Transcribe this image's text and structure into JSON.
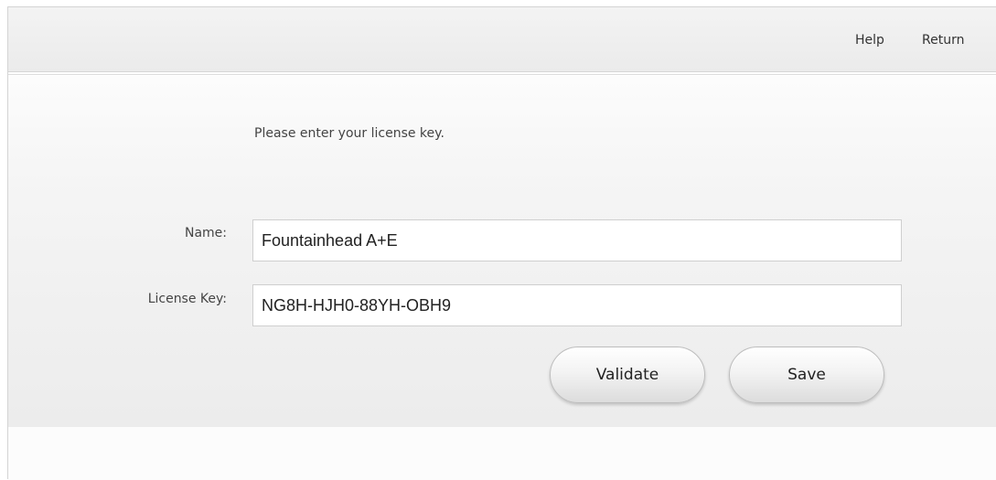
{
  "header": {
    "links": {
      "help": "Help",
      "return": "Return"
    }
  },
  "form": {
    "instruction": "Please enter your license key.",
    "name_label": "Name:",
    "name_value": "Fountainhead A+E",
    "license_key_label": "License Key:",
    "license_key_value": "NG8H-HJH0-88YH-OBH9"
  },
  "actions": {
    "validate_label": "Validate",
    "save_label": "Save"
  }
}
